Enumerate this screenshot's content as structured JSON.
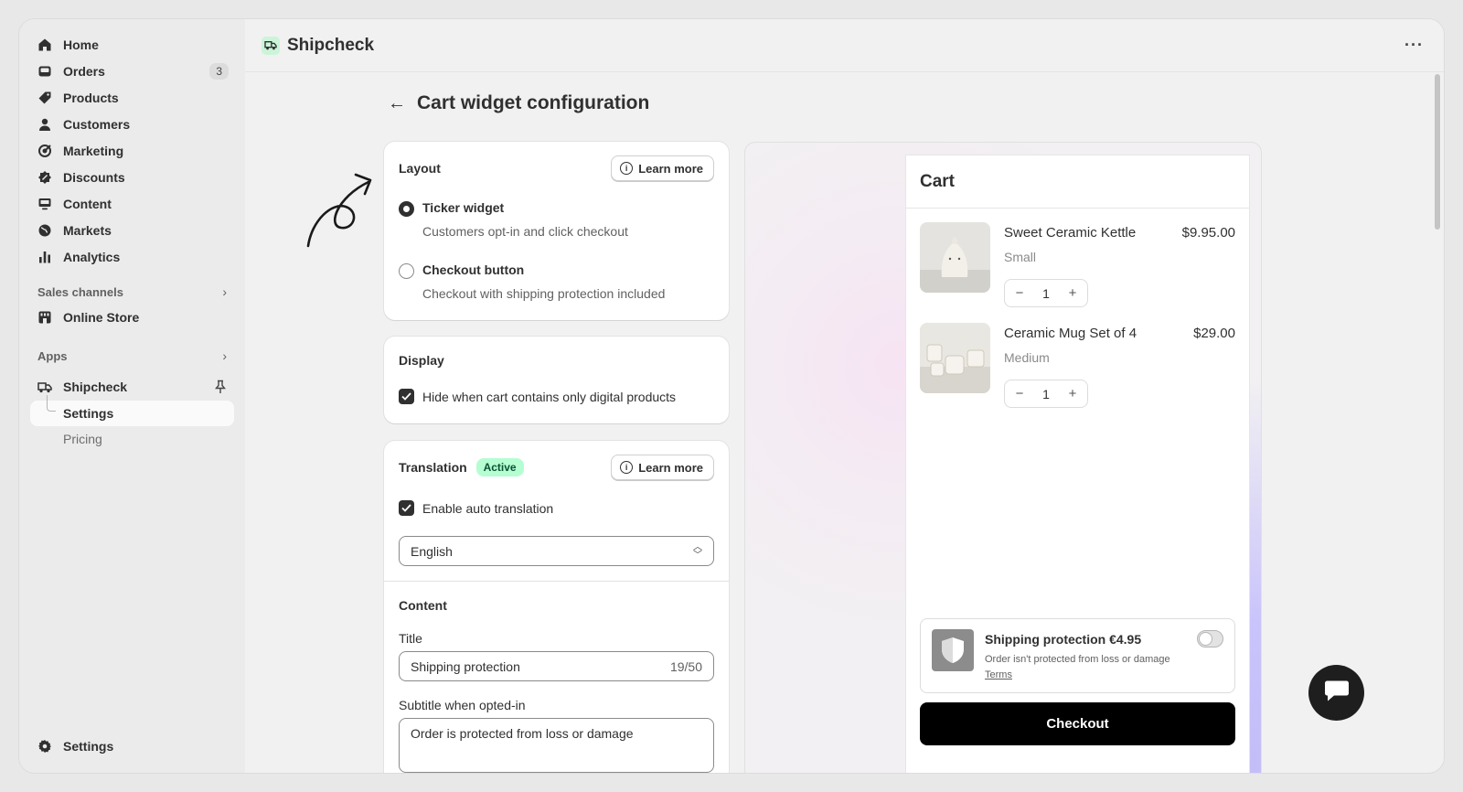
{
  "sidebar": {
    "nav": [
      {
        "label": "Home",
        "icon": "home-icon"
      },
      {
        "label": "Orders",
        "icon": "inbox-icon",
        "count": "3"
      },
      {
        "label": "Products",
        "icon": "tag-icon"
      },
      {
        "label": "Customers",
        "icon": "person-icon"
      },
      {
        "label": "Marketing",
        "icon": "target-icon"
      },
      {
        "label": "Discounts",
        "icon": "discount-icon"
      },
      {
        "label": "Content",
        "icon": "monitor-icon"
      },
      {
        "label": "Markets",
        "icon": "globe-icon"
      },
      {
        "label": "Analytics",
        "icon": "bar-chart-icon"
      }
    ],
    "sales_channels_label": "Sales channels",
    "online_store_label": "Online Store",
    "apps_label": "Apps",
    "app_name": "Shipcheck",
    "app_sub": [
      {
        "label": "Settings",
        "active": true
      },
      {
        "label": "Pricing",
        "active": false
      }
    ],
    "settings_label": "Settings"
  },
  "topbar": {
    "app_title": "Shipcheck",
    "more": "···"
  },
  "page": {
    "title": "Cart widget configuration"
  },
  "layout_card": {
    "title": "Layout",
    "learn_more": "Learn more",
    "options": [
      {
        "label": "Ticker widget",
        "desc": "Customers opt-in and click checkout",
        "selected": true
      },
      {
        "label": "Checkout button",
        "desc": "Checkout with shipping protection included",
        "selected": false
      }
    ]
  },
  "display_card": {
    "title": "Display",
    "checkbox_label": "Hide when cart contains only digital products"
  },
  "translation_card": {
    "title": "Translation",
    "badge": "Active",
    "learn_more": "Learn more",
    "checkbox_label": "Enable auto translation",
    "language": "English",
    "content_title": "Content",
    "title_field_label": "Title",
    "title_value": "Shipping protection",
    "title_counter": "19/50",
    "subtitle_label": "Subtitle when opted-in",
    "subtitle_value": "Order is protected from loss or damage"
  },
  "preview": {
    "cart_title": "Cart",
    "items": [
      {
        "name": "Sweet Ceramic Kettle",
        "variant": "Small",
        "price": "$9.95.00",
        "qty": "1"
      },
      {
        "name": "Ceramic Mug Set of 4",
        "variant": "Medium",
        "price": "$29.00",
        "qty": "1"
      }
    ],
    "protection_title": "Shipping protection €4.95",
    "protection_sub": "Order isn't protected from loss or damage",
    "protection_terms": "Terms",
    "protection_enabled": false,
    "checkout_label": "Checkout"
  },
  "colors": {
    "accent_badge_bg": "#b4fed2",
    "checkout_bg": "#000000",
    "sidebar_bg": "#ebebeb"
  }
}
